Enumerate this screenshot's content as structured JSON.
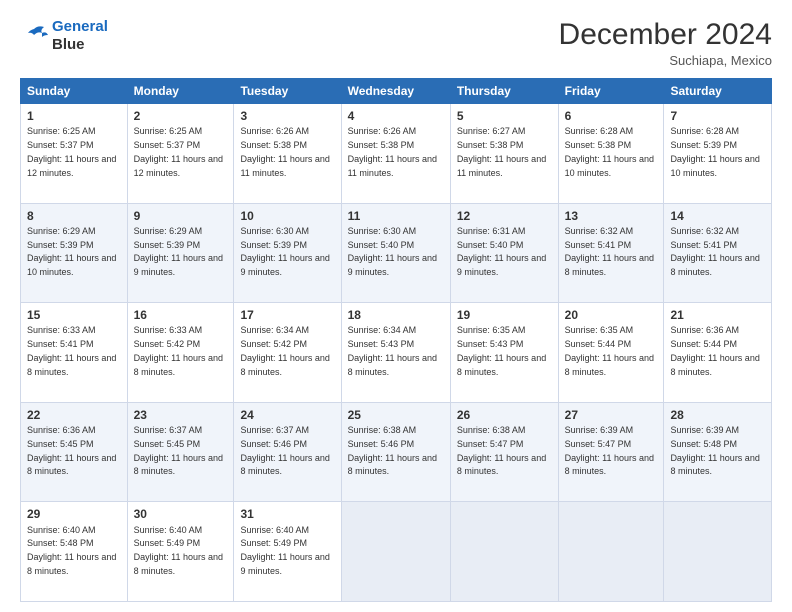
{
  "logo": {
    "line1": "General",
    "line2": "Blue"
  },
  "title": "December 2024",
  "subtitle": "Suchiapa, Mexico",
  "days_header": [
    "Sunday",
    "Monday",
    "Tuesday",
    "Wednesday",
    "Thursday",
    "Friday",
    "Saturday"
  ],
  "weeks": [
    [
      {
        "day": "1",
        "sunrise": "Sunrise: 6:25 AM",
        "sunset": "Sunset: 5:37 PM",
        "daylight": "Daylight: 11 hours and 12 minutes."
      },
      {
        "day": "2",
        "sunrise": "Sunrise: 6:25 AM",
        "sunset": "Sunset: 5:37 PM",
        "daylight": "Daylight: 11 hours and 12 minutes."
      },
      {
        "day": "3",
        "sunrise": "Sunrise: 6:26 AM",
        "sunset": "Sunset: 5:38 PM",
        "daylight": "Daylight: 11 hours and 11 minutes."
      },
      {
        "day": "4",
        "sunrise": "Sunrise: 6:26 AM",
        "sunset": "Sunset: 5:38 PM",
        "daylight": "Daylight: 11 hours and 11 minutes."
      },
      {
        "day": "5",
        "sunrise": "Sunrise: 6:27 AM",
        "sunset": "Sunset: 5:38 PM",
        "daylight": "Daylight: 11 hours and 11 minutes."
      },
      {
        "day": "6",
        "sunrise": "Sunrise: 6:28 AM",
        "sunset": "Sunset: 5:38 PM",
        "daylight": "Daylight: 11 hours and 10 minutes."
      },
      {
        "day": "7",
        "sunrise": "Sunrise: 6:28 AM",
        "sunset": "Sunset: 5:39 PM",
        "daylight": "Daylight: 11 hours and 10 minutes."
      }
    ],
    [
      {
        "day": "8",
        "sunrise": "Sunrise: 6:29 AM",
        "sunset": "Sunset: 5:39 PM",
        "daylight": "Daylight: 11 hours and 10 minutes."
      },
      {
        "day": "9",
        "sunrise": "Sunrise: 6:29 AM",
        "sunset": "Sunset: 5:39 PM",
        "daylight": "Daylight: 11 hours and 9 minutes."
      },
      {
        "day": "10",
        "sunrise": "Sunrise: 6:30 AM",
        "sunset": "Sunset: 5:39 PM",
        "daylight": "Daylight: 11 hours and 9 minutes."
      },
      {
        "day": "11",
        "sunrise": "Sunrise: 6:30 AM",
        "sunset": "Sunset: 5:40 PM",
        "daylight": "Daylight: 11 hours and 9 minutes."
      },
      {
        "day": "12",
        "sunrise": "Sunrise: 6:31 AM",
        "sunset": "Sunset: 5:40 PM",
        "daylight": "Daylight: 11 hours and 9 minutes."
      },
      {
        "day": "13",
        "sunrise": "Sunrise: 6:32 AM",
        "sunset": "Sunset: 5:41 PM",
        "daylight": "Daylight: 11 hours and 8 minutes."
      },
      {
        "day": "14",
        "sunrise": "Sunrise: 6:32 AM",
        "sunset": "Sunset: 5:41 PM",
        "daylight": "Daylight: 11 hours and 8 minutes."
      }
    ],
    [
      {
        "day": "15",
        "sunrise": "Sunrise: 6:33 AM",
        "sunset": "Sunset: 5:41 PM",
        "daylight": "Daylight: 11 hours and 8 minutes."
      },
      {
        "day": "16",
        "sunrise": "Sunrise: 6:33 AM",
        "sunset": "Sunset: 5:42 PM",
        "daylight": "Daylight: 11 hours and 8 minutes."
      },
      {
        "day": "17",
        "sunrise": "Sunrise: 6:34 AM",
        "sunset": "Sunset: 5:42 PM",
        "daylight": "Daylight: 11 hours and 8 minutes."
      },
      {
        "day": "18",
        "sunrise": "Sunrise: 6:34 AM",
        "sunset": "Sunset: 5:43 PM",
        "daylight": "Daylight: 11 hours and 8 minutes."
      },
      {
        "day": "19",
        "sunrise": "Sunrise: 6:35 AM",
        "sunset": "Sunset: 5:43 PM",
        "daylight": "Daylight: 11 hours and 8 minutes."
      },
      {
        "day": "20",
        "sunrise": "Sunrise: 6:35 AM",
        "sunset": "Sunset: 5:44 PM",
        "daylight": "Daylight: 11 hours and 8 minutes."
      },
      {
        "day": "21",
        "sunrise": "Sunrise: 6:36 AM",
        "sunset": "Sunset: 5:44 PM",
        "daylight": "Daylight: 11 hours and 8 minutes."
      }
    ],
    [
      {
        "day": "22",
        "sunrise": "Sunrise: 6:36 AM",
        "sunset": "Sunset: 5:45 PM",
        "daylight": "Daylight: 11 hours and 8 minutes."
      },
      {
        "day": "23",
        "sunrise": "Sunrise: 6:37 AM",
        "sunset": "Sunset: 5:45 PM",
        "daylight": "Daylight: 11 hours and 8 minutes."
      },
      {
        "day": "24",
        "sunrise": "Sunrise: 6:37 AM",
        "sunset": "Sunset: 5:46 PM",
        "daylight": "Daylight: 11 hours and 8 minutes."
      },
      {
        "day": "25",
        "sunrise": "Sunrise: 6:38 AM",
        "sunset": "Sunset: 5:46 PM",
        "daylight": "Daylight: 11 hours and 8 minutes."
      },
      {
        "day": "26",
        "sunrise": "Sunrise: 6:38 AM",
        "sunset": "Sunset: 5:47 PM",
        "daylight": "Daylight: 11 hours and 8 minutes."
      },
      {
        "day": "27",
        "sunrise": "Sunrise: 6:39 AM",
        "sunset": "Sunset: 5:47 PM",
        "daylight": "Daylight: 11 hours and 8 minutes."
      },
      {
        "day": "28",
        "sunrise": "Sunrise: 6:39 AM",
        "sunset": "Sunset: 5:48 PM",
        "daylight": "Daylight: 11 hours and 8 minutes."
      }
    ],
    [
      {
        "day": "29",
        "sunrise": "Sunrise: 6:40 AM",
        "sunset": "Sunset: 5:48 PM",
        "daylight": "Daylight: 11 hours and 8 minutes."
      },
      {
        "day": "30",
        "sunrise": "Sunrise: 6:40 AM",
        "sunset": "Sunset: 5:49 PM",
        "daylight": "Daylight: 11 hours and 8 minutes."
      },
      {
        "day": "31",
        "sunrise": "Sunrise: 6:40 AM",
        "sunset": "Sunset: 5:49 PM",
        "daylight": "Daylight: 11 hours and 9 minutes."
      },
      null,
      null,
      null,
      null
    ]
  ]
}
